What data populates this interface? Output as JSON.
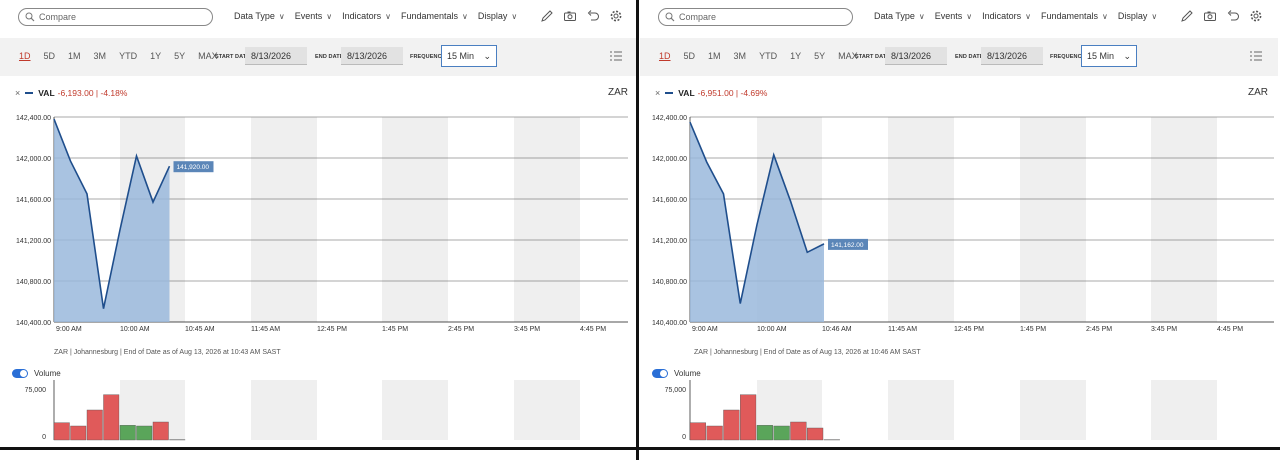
{
  "toolbar": {
    "compare_placeholder": "Compare",
    "menus": [
      "Data Type",
      "Events",
      "Indicators",
      "Fundamentals",
      "Display"
    ]
  },
  "ranges": [
    "1D",
    "5D",
    "1M",
    "3M",
    "YTD",
    "1Y",
    "5Y",
    "MAX"
  ],
  "active_range": "1D",
  "start_date_label": "START DATE",
  "end_date_label": "END DATE",
  "frequency_label": "FREQUENCY",
  "panes": [
    {
      "start_date": "8/13/2026",
      "end_date": "8/13/2026",
      "frequency": "15 Min",
      "symbol": "VAL",
      "change": "-6,193.00 | -4.18%",
      "currency": "ZAR",
      "last_price_label": "141,920.00",
      "footnote": "ZAR | Johannesburg | End of Date as of Aug 13, 2026 at 10:43 AM SAST",
      "x_ticks": [
        "9:00 AM",
        "10:00 AM",
        "10:45 AM",
        "11:45 AM",
        "12:45 PM",
        "1:45 PM",
        "2:45 PM",
        "3:45 PM",
        "4:45 PM"
      ],
      "volume_label": "Volume",
      "vol_ticks": [
        "75,000",
        "0"
      ]
    },
    {
      "start_date": "8/13/2026",
      "end_date": "8/13/2026",
      "frequency": "15 Min",
      "symbol": "VAL",
      "change": "-6,951.00 | -4.69%",
      "currency": "ZAR",
      "last_price_label": "141,162.00",
      "footnote": "ZAR | Johannesburg | End of Date as of Aug 13, 2026 at 10:46 AM SAST",
      "x_ticks": [
        "9:00 AM",
        "10:00 AM",
        "10:46 AM",
        "11:45 AM",
        "12:45 PM",
        "1:45 PM",
        "2:45 PM",
        "3:45 PM",
        "4:45 PM"
      ],
      "volume_label": "Volume",
      "vol_ticks": [
        "75,000",
        "0"
      ]
    }
  ],
  "chart_data": [
    {
      "type": "area",
      "ylim": [
        140400,
        142400
      ],
      "y_ticks": [
        "142,400.00",
        "142,000.00",
        "141,600.00",
        "141,200.00",
        "140,800.00",
        "140,400.00"
      ],
      "x_ticks": [
        "9:00 AM",
        "10:00 AM",
        "10:45 AM",
        "11:45 AM",
        "12:45 PM",
        "1:45 PM",
        "2:45 PM",
        "3:45 PM",
        "4:45 PM"
      ],
      "series": [
        {
          "values": [
            142380,
            141970,
            141650,
            140530,
            141300,
            142020,
            141570,
            141920
          ]
        }
      ],
      "volume": {
        "values": [
          26000,
          21000,
          45000,
          68000,
          22000,
          21000,
          27000,
          500
        ],
        "direction": [
          "down",
          "down",
          "down",
          "down",
          "up",
          "up",
          "down",
          "down"
        ]
      },
      "colors": {
        "line": "#1f4e8c",
        "fill": "#9ab9dc",
        "vol_down": "#e05a5a",
        "vol_up": "#5aa55a"
      }
    },
    {
      "type": "area",
      "ylim": [
        140400,
        142400
      ],
      "y_ticks": [
        "142,400.00",
        "142,000.00",
        "141,600.00",
        "141,200.00",
        "140,800.00",
        "140,400.00"
      ],
      "x_ticks": [
        "9:00 AM",
        "10:00 AM",
        "10:46 AM",
        "11:45 AM",
        "12:45 PM",
        "1:45 PM",
        "2:45 PM",
        "3:45 PM",
        "4:45 PM"
      ],
      "series": [
        {
          "values": [
            142350,
            141960,
            141650,
            140580,
            141350,
            142030,
            141580,
            141080,
            141162
          ]
        }
      ],
      "volume": {
        "values": [
          26000,
          21000,
          45000,
          68000,
          22000,
          21000,
          27000,
          18000,
          500
        ],
        "direction": [
          "down",
          "down",
          "down",
          "down",
          "up",
          "up",
          "down",
          "down",
          "down"
        ]
      },
      "colors": {
        "line": "#1f4e8c",
        "fill": "#9ab9dc",
        "vol_down": "#e05a5a",
        "vol_up": "#5aa55a"
      }
    }
  ]
}
